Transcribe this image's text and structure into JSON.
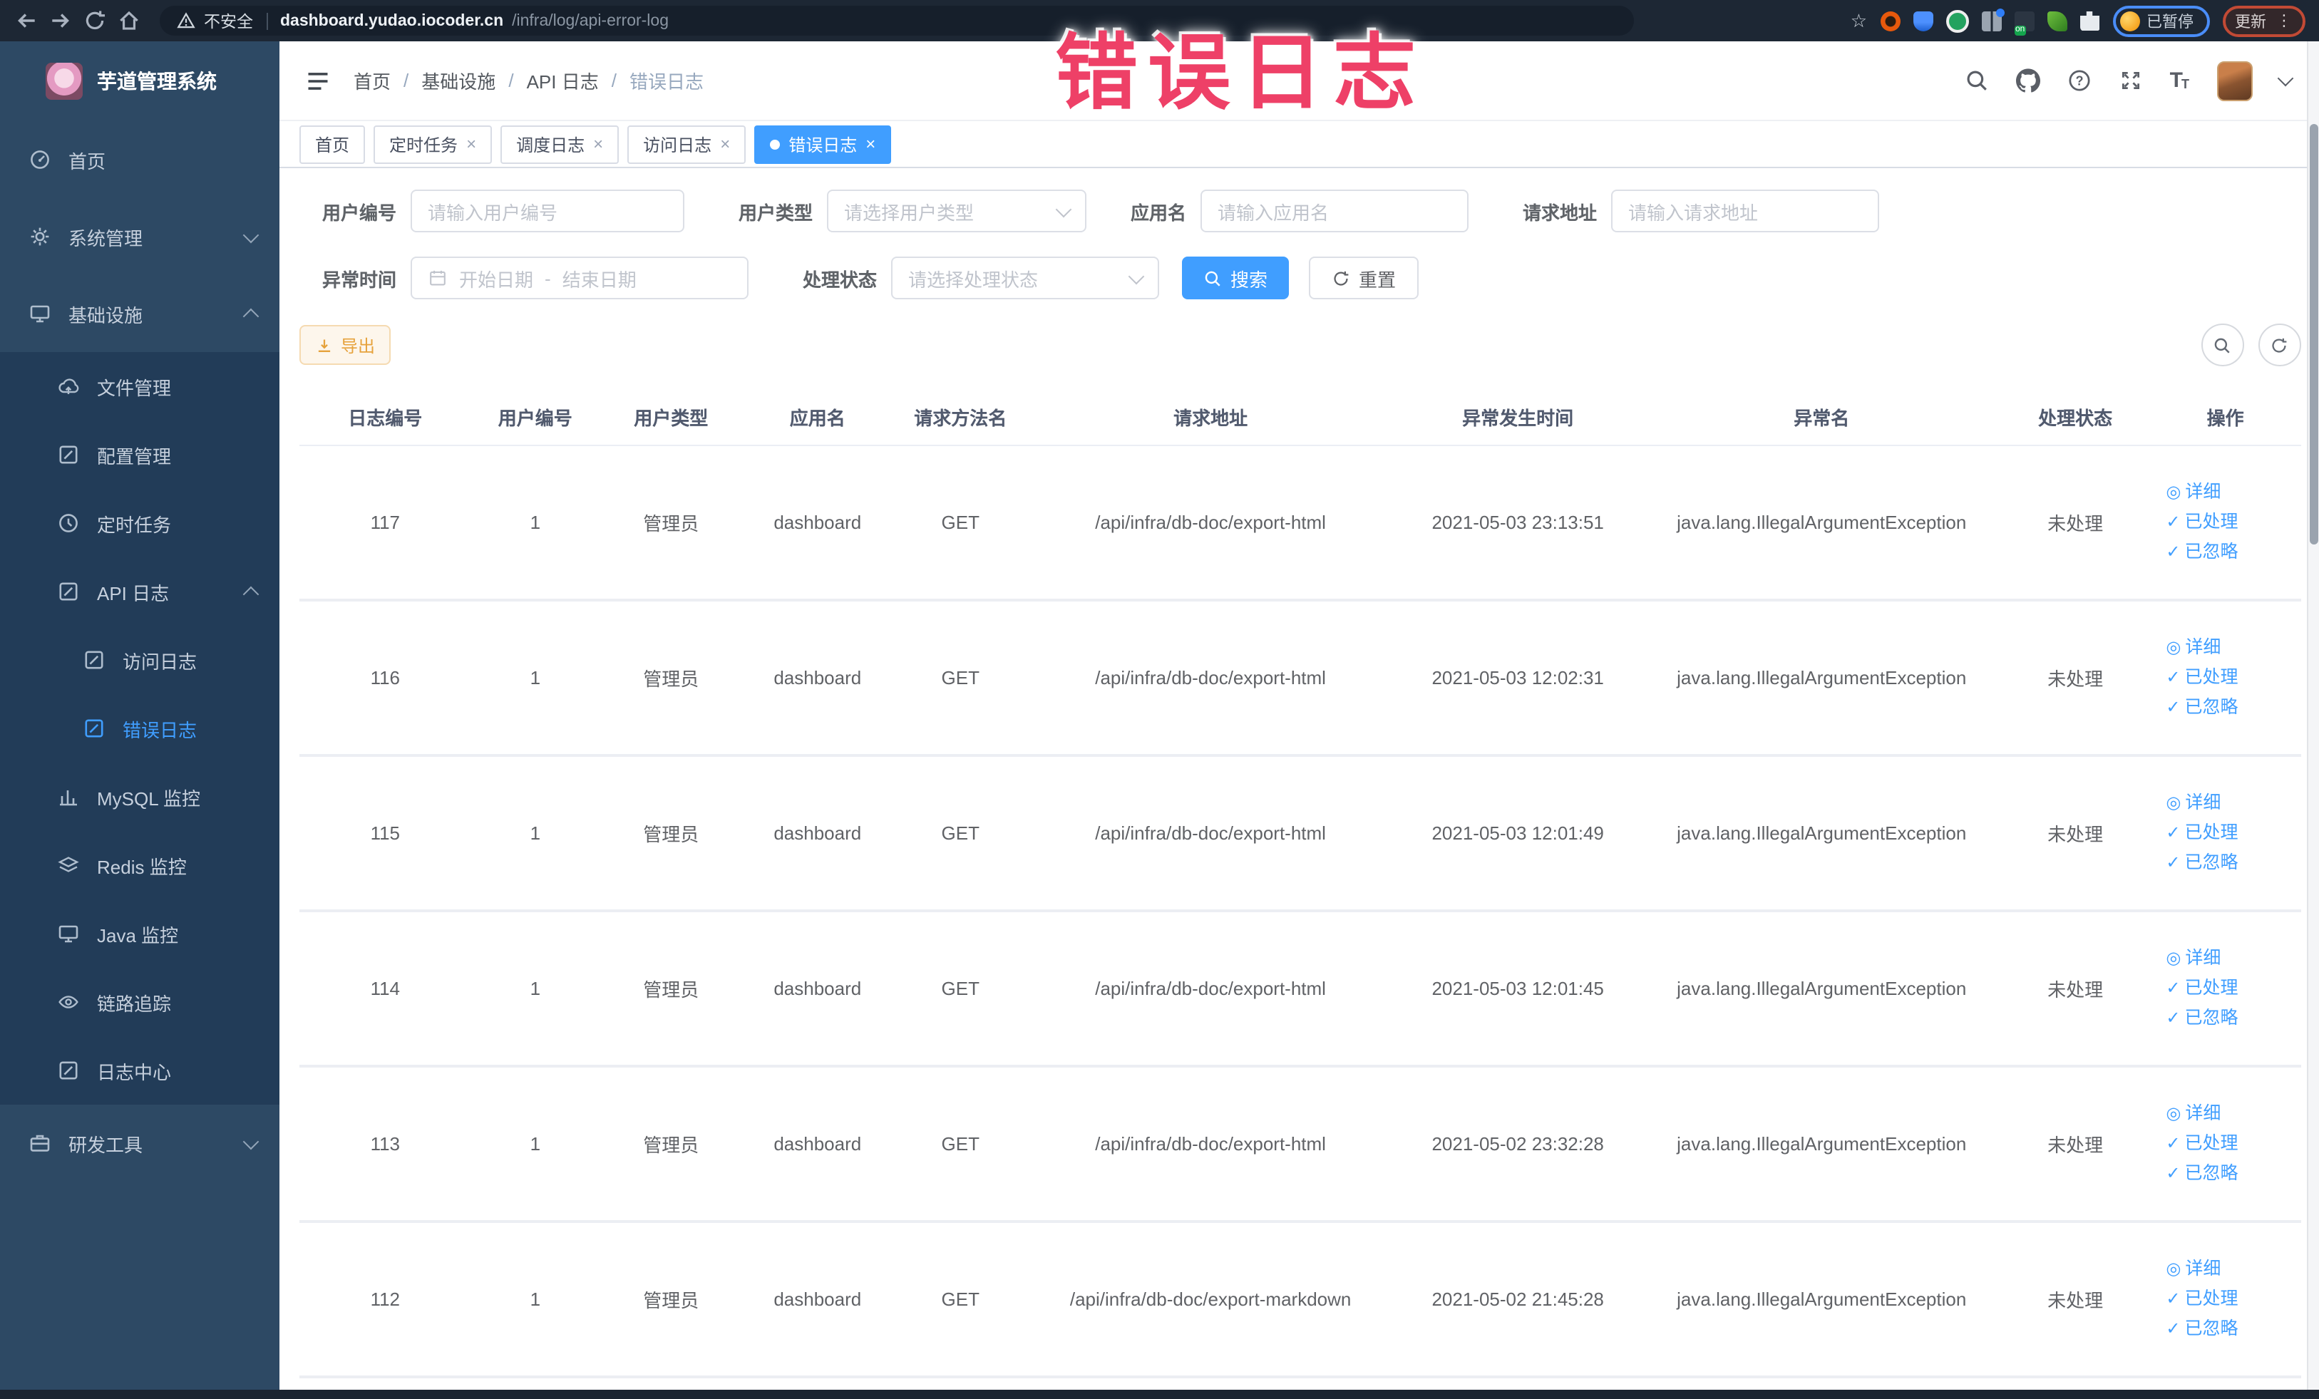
{
  "annotation": {
    "text": "错误日志",
    "color": "#ee4067"
  },
  "browser": {
    "security": "不安全",
    "url_host": "dashboard.yudao.iocoder.cn",
    "url_path": "/infra/log/api-error-log",
    "profile_status": "已暂停",
    "update_label": "更新"
  },
  "app": {
    "title": "芋道管理系统"
  },
  "sidebar": {
    "items": [
      {
        "label": "首页"
      },
      {
        "label": "系统管理"
      },
      {
        "label": "基础设施"
      },
      {
        "label": "文件管理"
      },
      {
        "label": "配置管理"
      },
      {
        "label": "定时任务"
      },
      {
        "label": "API 日志"
      },
      {
        "label": "访问日志"
      },
      {
        "label": "错误日志"
      },
      {
        "label": "MySQL 监控"
      },
      {
        "label": "Redis 监控"
      },
      {
        "label": "Java 监控"
      },
      {
        "label": "链路追踪"
      },
      {
        "label": "日志中心"
      },
      {
        "label": "研发工具"
      }
    ]
  },
  "breadcrumb": {
    "items": [
      "首页",
      "基础设施",
      "API 日志",
      "错误日志"
    ]
  },
  "tabs": [
    {
      "label": "首页"
    },
    {
      "label": "定时任务"
    },
    {
      "label": "调度日志"
    },
    {
      "label": "访问日志"
    },
    {
      "label": "错误日志"
    }
  ],
  "filters": {
    "user_id": {
      "label": "用户编号",
      "placeholder": "请输入用户编号"
    },
    "user_type": {
      "label": "用户类型",
      "placeholder": "请选择用户类型"
    },
    "app_name": {
      "label": "应用名",
      "placeholder": "请输入应用名"
    },
    "request_url": {
      "label": "请求地址",
      "placeholder": "请输入请求地址"
    },
    "exception_time": {
      "label": "异常时间",
      "start_placeholder": "开始日期",
      "separator": "-",
      "end_placeholder": "结束日期"
    },
    "process_status": {
      "label": "处理状态",
      "placeholder": "请选择处理状态"
    },
    "search_label": "搜索",
    "reset_label": "重置"
  },
  "toolbar": {
    "export_label": "导出"
  },
  "table": {
    "columns": [
      "日志编号",
      "用户编号",
      "用户类型",
      "应用名",
      "请求方法名",
      "请求地址",
      "异常发生时间",
      "异常名",
      "处理状态",
      "操作"
    ],
    "actions": {
      "detail": "详细",
      "processed": "已处理",
      "ignored": "已忽略"
    },
    "rows": [
      {
        "id": "117",
        "user_id": "1",
        "user_type": "管理员",
        "app": "dashboard",
        "method": "GET",
        "url": "/api/infra/db-doc/export-html",
        "time": "2021-05-03 23:13:51",
        "exception": "java.lang.IllegalArgumentException",
        "status": "未处理"
      },
      {
        "id": "116",
        "user_id": "1",
        "user_type": "管理员",
        "app": "dashboard",
        "method": "GET",
        "url": "/api/infra/db-doc/export-html",
        "time": "2021-05-03 12:02:31",
        "exception": "java.lang.IllegalArgumentException",
        "status": "未处理"
      },
      {
        "id": "115",
        "user_id": "1",
        "user_type": "管理员",
        "app": "dashboard",
        "method": "GET",
        "url": "/api/infra/db-doc/export-html",
        "time": "2021-05-03 12:01:49",
        "exception": "java.lang.IllegalArgumentException",
        "status": "未处理"
      },
      {
        "id": "114",
        "user_id": "1",
        "user_type": "管理员",
        "app": "dashboard",
        "method": "GET",
        "url": "/api/infra/db-doc/export-html",
        "time": "2021-05-03 12:01:45",
        "exception": "java.lang.IllegalArgumentException",
        "status": "未处理"
      },
      {
        "id": "113",
        "user_id": "1",
        "user_type": "管理员",
        "app": "dashboard",
        "method": "GET",
        "url": "/api/infra/db-doc/export-html",
        "time": "2021-05-02 23:32:28",
        "exception": "java.lang.IllegalArgumentException",
        "status": "未处理"
      },
      {
        "id": "112",
        "user_id": "1",
        "user_type": "管理员",
        "app": "dashboard",
        "method": "GET",
        "url": "/api/infra/db-doc/export-markdown",
        "time": "2021-05-02 21:45:28",
        "exception": "java.lang.IllegalArgumentException",
        "status": "未处理"
      }
    ]
  }
}
